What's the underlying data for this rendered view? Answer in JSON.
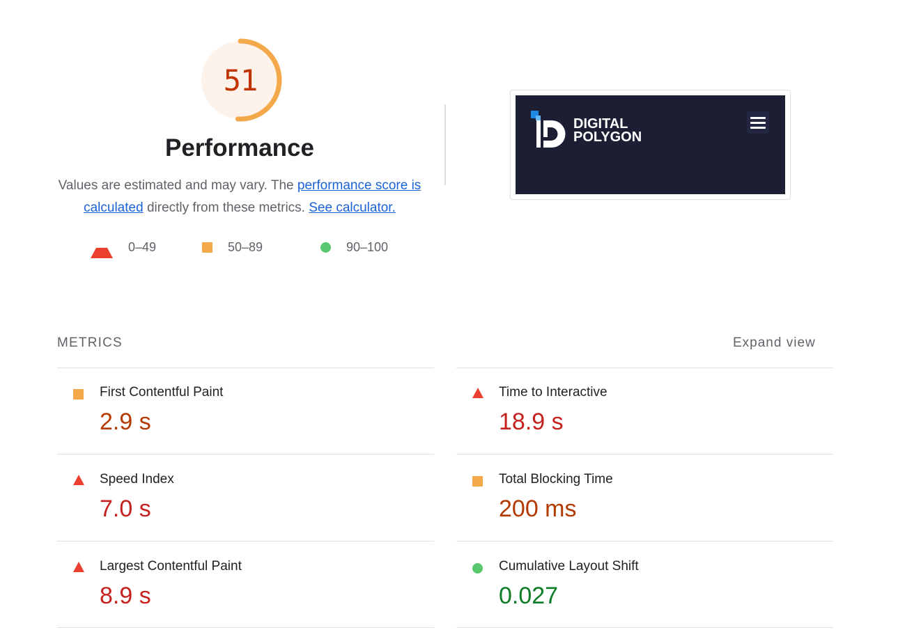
{
  "score": {
    "value": "51",
    "fraction": 0.51,
    "color": "#f3a94a",
    "bg": "#fef3ea",
    "text_color": "#c33300"
  },
  "category": {
    "title": "Performance"
  },
  "description": {
    "part1": "Values are estimated and may vary. The ",
    "link1": "performance score is calculated",
    "part2": " directly from these metrics. ",
    "link2": "See calculator."
  },
  "legend": {
    "fail": {
      "range": "0–49",
      "icon": "triangle-icon",
      "color": "#eb3f2f"
    },
    "average": {
      "range": "50–89",
      "icon": "square-icon",
      "color": "#f3a94a"
    },
    "pass": {
      "range": "90–100",
      "icon": "circle-icon",
      "color": "#5ac86f"
    }
  },
  "screenshot": {
    "brand_line1": "DIGITAL",
    "brand_line2": "POLYGON",
    "background": "#1c1f33",
    "menu_icon": "hamburger-menu-icon"
  },
  "metrics": {
    "heading": "METRICS",
    "expand_label": "Expand view",
    "items": [
      {
        "label": "First Contentful Paint",
        "value": "2.9 s",
        "rating": "average"
      },
      {
        "label": "Time to Interactive",
        "value": "18.9 s",
        "rating": "fail"
      },
      {
        "label": "Speed Index",
        "value": "7.0 s",
        "rating": "fail"
      },
      {
        "label": "Total Blocking Time",
        "value": "200 ms",
        "rating": "average"
      },
      {
        "label": "Largest Contentful Paint",
        "value": "8.9 s",
        "rating": "fail"
      },
      {
        "label": "Cumulative Layout Shift",
        "value": "0.027",
        "rating": "pass"
      }
    ]
  }
}
